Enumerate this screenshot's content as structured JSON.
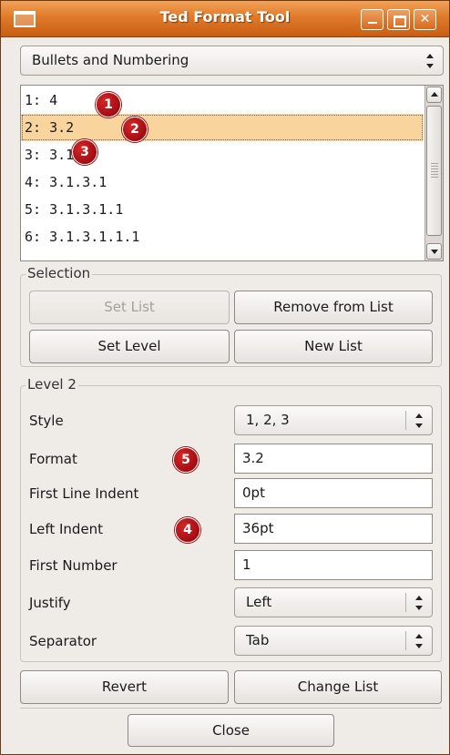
{
  "window": {
    "title": "Ted Format Tool"
  },
  "tool_select": {
    "value": "Bullets and Numbering"
  },
  "list": {
    "items": [
      "1: 4",
      "2: 3.2",
      "3: 3.1.4",
      "4: 3.1.3.1",
      "5: 3.1.3.1.1",
      "6: 3.1.3.1.1.1"
    ],
    "selected_index": 1
  },
  "selection": {
    "label": "Selection",
    "set_list": "Set List",
    "remove_from_list": "Remove from List",
    "set_level": "Set Level",
    "new_list": "New List"
  },
  "level": {
    "label": "Level 2",
    "style_label": "Style",
    "style_value": "1, 2, 3",
    "format_label": "Format",
    "format_value": "3.2",
    "first_line_indent_label": "First Line Indent",
    "first_line_indent_value": "0pt",
    "left_indent_label": "Left Indent",
    "left_indent_value": "36pt",
    "first_number_label": "First Number",
    "first_number_value": "1",
    "justify_label": "Justify",
    "justify_value": "Left",
    "separator_label": "Separator",
    "separator_value": "Tab"
  },
  "actions": {
    "revert": "Revert",
    "change_list": "Change List",
    "close": "Close"
  },
  "annotations": [
    "1",
    "2",
    "3",
    "4",
    "5"
  ],
  "colors": {
    "titlebar": "#e07a2a",
    "selection": "#f9d49c",
    "badge": "#a30c10"
  }
}
